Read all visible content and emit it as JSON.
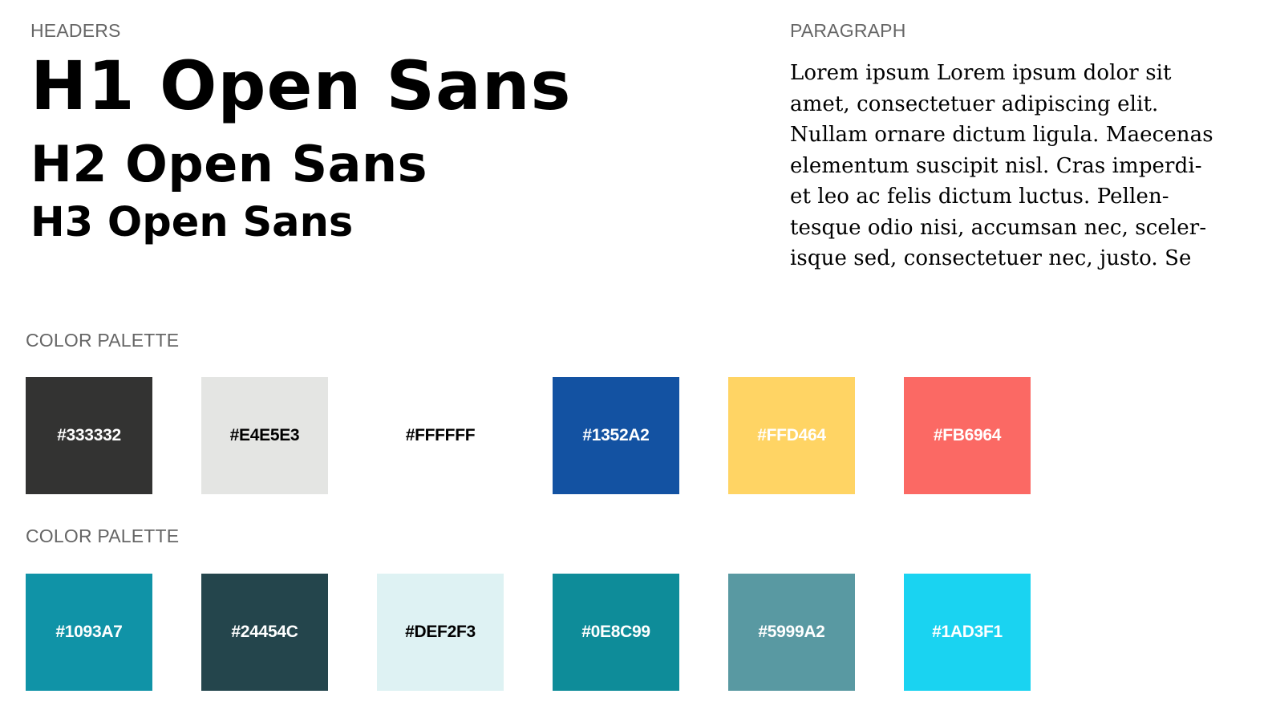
{
  "headers": {
    "label": "HEADERS",
    "h1": "H1 Open Sans",
    "h2": "H2 Open Sans",
    "h3": "H3 Open Sans"
  },
  "paragraph": {
    "label": "PARAGRAPH",
    "lines": [
      "Lorem ipsum Lorem ipsum dolor sit",
      "amet, consectetuer adipiscing elit.",
      "Nullam ornare dictum ligula. Maecenas",
      "elementum suscipit nisl. Cras imperdi-",
      "et leo ac felis dictum luctus. Pellen-",
      "tesque odio nisi, accumsan nec, sceler-",
      "isque sed, consectetuer nec, justo. Se"
    ]
  },
  "palettes": [
    {
      "label": "COLOR PALETTE",
      "swatches": [
        {
          "code": "#333332",
          "color": "#333332",
          "text_color": "#ffffff"
        },
        {
          "code": "#E4E5E3",
          "color": "#E4E5E3",
          "text_color": "#000000"
        },
        {
          "code": "#FFFFFF",
          "color": "#FFFFFF",
          "text_color": "#000000"
        },
        {
          "code": "#1352A2",
          "color": "#1352A2",
          "text_color": "#ffffff"
        },
        {
          "code": "#FFD464",
          "color": "#FFD464",
          "text_color": "#ffffff"
        },
        {
          "code": "#FB6964",
          "color": "#FB6964",
          "text_color": "#ffffff"
        }
      ]
    },
    {
      "label": "COLOR PALETTE",
      "swatches": [
        {
          "code": "#1093A7",
          "color": "#1093A7",
          "text_color": "#ffffff"
        },
        {
          "code": "#24454C",
          "color": "#24454C",
          "text_color": "#ffffff"
        },
        {
          "code": "#DEF2F3",
          "color": "#DEF2F3",
          "text_color": "#000000"
        },
        {
          "code": "#0E8C99",
          "color": "#0E8C99",
          "text_color": "#ffffff"
        },
        {
          "code": "#5999A2",
          "color": "#5999A2",
          "text_color": "#ffffff"
        },
        {
          "code": "#1AD3F1",
          "color": "#1AD3F1",
          "text_color": "#ffffff"
        }
      ]
    }
  ]
}
